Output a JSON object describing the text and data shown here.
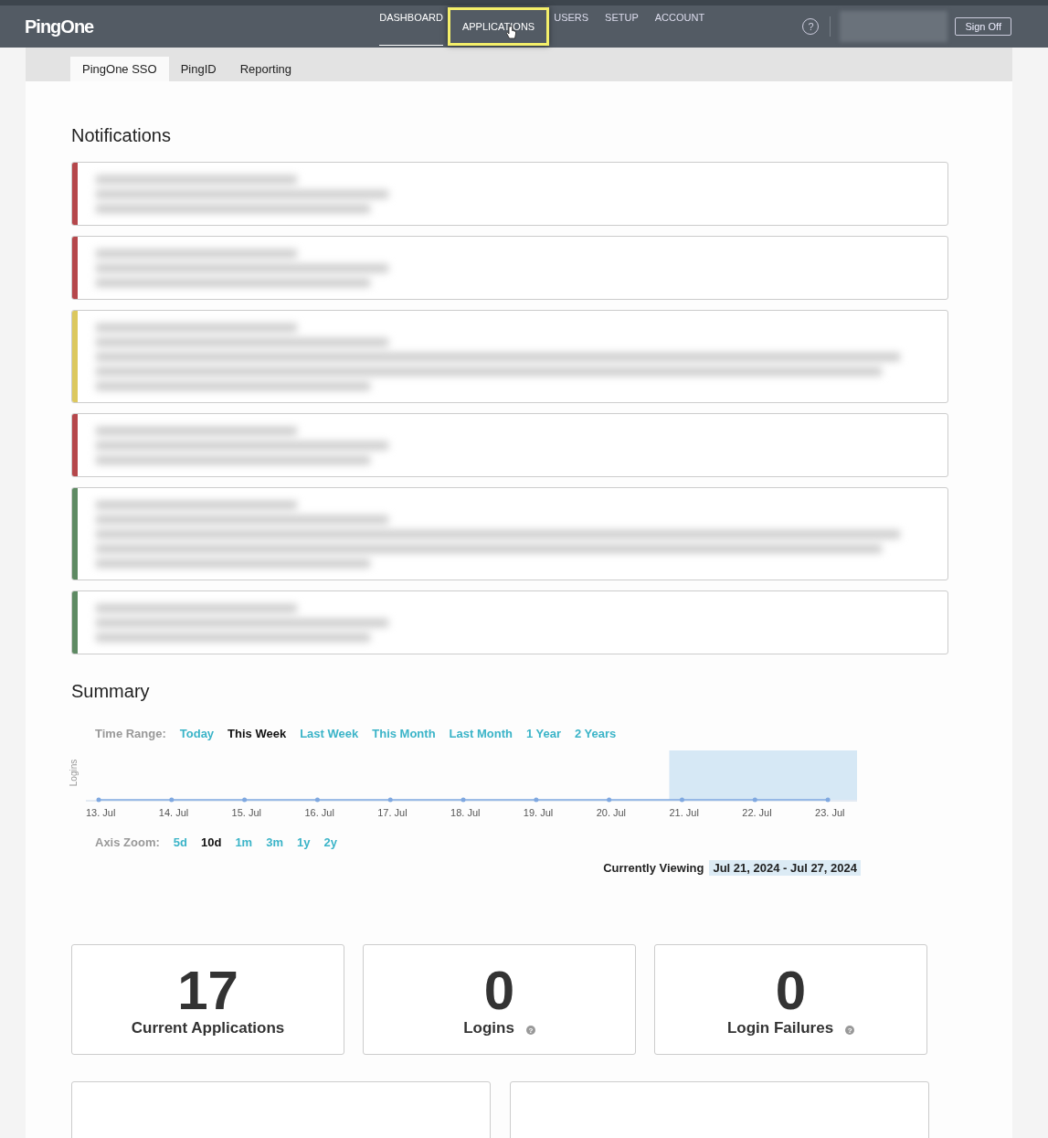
{
  "header": {
    "logo": "PingOne",
    "nav": [
      {
        "label": "DASHBOARD",
        "selected": true,
        "highlighted": false
      },
      {
        "label": "APPLICATIONS",
        "selected": false,
        "highlighted": true
      },
      {
        "label": "USERS",
        "selected": false,
        "highlighted": false
      },
      {
        "label": "SETUP",
        "selected": false,
        "highlighted": false
      },
      {
        "label": "ACCOUNT",
        "selected": false,
        "highlighted": false
      }
    ],
    "help": "?",
    "sign_off": "Sign Off"
  },
  "subtabs": [
    {
      "label": "PingOne SSO",
      "selected": true
    },
    {
      "label": "PingID",
      "selected": false
    },
    {
      "label": "Reporting",
      "selected": false
    }
  ],
  "notifications": {
    "title": "Notifications",
    "items": [
      {
        "color": "#b5474b",
        "kind": "short"
      },
      {
        "color": "#b5474b",
        "kind": "short"
      },
      {
        "color": "#dcc85e",
        "kind": "tall"
      },
      {
        "color": "#b5474b",
        "kind": "short"
      },
      {
        "color": "#5e8a63",
        "kind": "tall"
      },
      {
        "color": "#5e8a63",
        "kind": "short"
      }
    ]
  },
  "summary": {
    "title": "Summary",
    "time_range_label": "Time Range:",
    "time_ranges": [
      {
        "label": "Today",
        "selected": false
      },
      {
        "label": "This Week",
        "selected": true
      },
      {
        "label": "Last Week",
        "selected": false
      },
      {
        "label": "This Month",
        "selected": false
      },
      {
        "label": "Last Month",
        "selected": false
      },
      {
        "label": "1 Year",
        "selected": false
      },
      {
        "label": "2 Years",
        "selected": false
      }
    ],
    "chart": {
      "y_label": "Logins",
      "x_labels": [
        "13. Jul",
        "14. Jul",
        "15. Jul",
        "16. Jul",
        "17. Jul",
        "18. Jul",
        "19. Jul",
        "20. Jul",
        "21. Jul",
        "22. Jul",
        "23. Jul"
      ]
    },
    "axis_zoom_label": "Axis Zoom:",
    "axis_zooms": [
      {
        "label": "5d",
        "selected": false
      },
      {
        "label": "10d",
        "selected": true
      },
      {
        "label": "1m",
        "selected": false
      },
      {
        "label": "3m",
        "selected": false
      },
      {
        "label": "1y",
        "selected": false
      },
      {
        "label": "2y",
        "selected": false
      }
    ],
    "viewing_label": "Currently Viewing",
    "viewing_range": "Jul 21, 2024 - Jul 27, 2024"
  },
  "stats": [
    {
      "value": "17",
      "label": "Current Applications"
    },
    {
      "value": "0",
      "label": "Logins",
      "help": "?"
    },
    {
      "value": "0",
      "label": "Login Failures",
      "help": "?"
    }
  ],
  "panels": [
    {
      "kind": "empty"
    },
    {
      "kind": "empty"
    }
  ]
}
